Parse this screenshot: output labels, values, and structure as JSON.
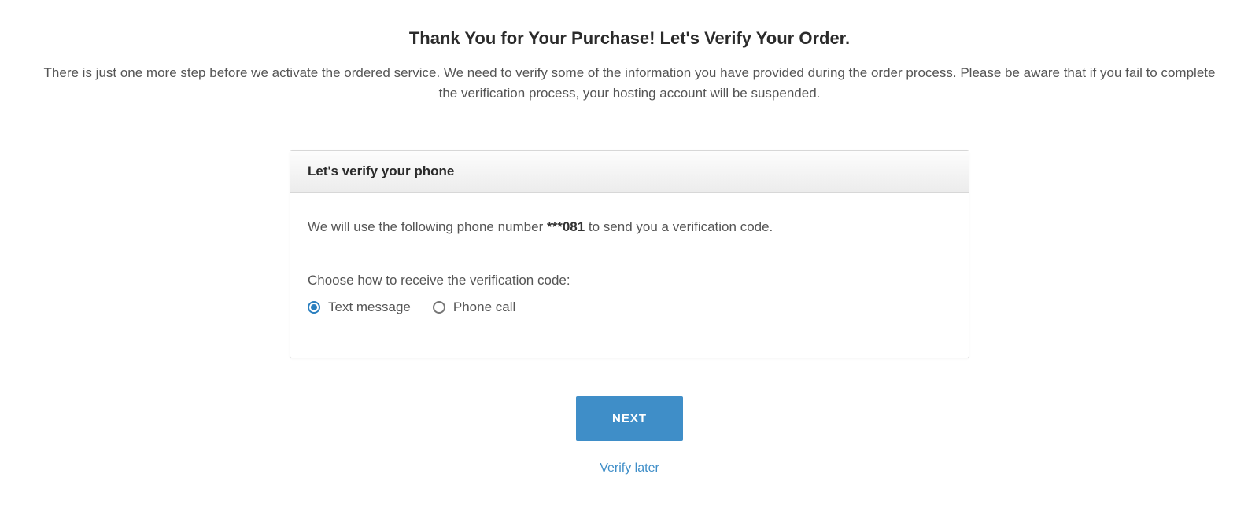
{
  "header": {
    "headline": "Thank You for Your Purchase! Let's Verify Your Order.",
    "subtext": "There is just one more step before we activate the ordered service. We need to verify some of the information you have provided during the order process. Please be aware that if you fail to complete the verification process, your hosting account will be suspended."
  },
  "card": {
    "title": "Let's verify your phone",
    "phone_line_pre": "We will use the following phone number ",
    "phone_masked": "***081",
    "phone_line_post": " to send you a verification code.",
    "choose_label": "Choose how to receive the verification code:",
    "options": {
      "text_message": "Text message",
      "phone_call": "Phone call",
      "selected": "text_message"
    }
  },
  "actions": {
    "next": "Next",
    "verify_later": "Verify later"
  }
}
